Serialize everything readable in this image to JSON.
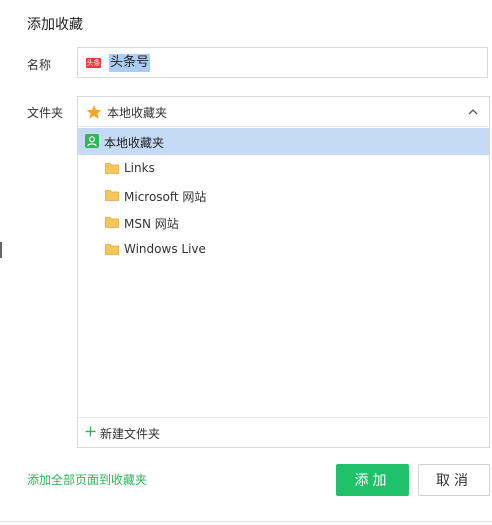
{
  "dialog": {
    "title": "添加收藏",
    "name_label": "名称",
    "folder_label": "文件夹"
  },
  "name_field": {
    "site_icon_text": "头条",
    "value": "头条号"
  },
  "folder_select": {
    "selected": "本地收藏夹",
    "icon": "star-icon",
    "expanded": true
  },
  "tree": {
    "root": {
      "label": "本地收藏夹",
      "icon": "user-icon"
    },
    "items": [
      {
        "label": "Links",
        "icon": "folder-icon"
      },
      {
        "label": "Microsoft 网站",
        "icon": "folder-icon"
      },
      {
        "label": "MSN 网站",
        "icon": "folder-icon"
      },
      {
        "label": "Windows Live",
        "icon": "folder-icon"
      }
    ]
  },
  "new_folder": {
    "label": "新建文件夹"
  },
  "footer": {
    "add_all_link": "添加全部页面到收藏夹",
    "add_button": "添加",
    "cancel_button": "取消"
  },
  "colors": {
    "accent_green": "#21c06b",
    "link_green": "#2fb45a",
    "selection_blue": "#c4daf5",
    "star_orange": "#f5a623",
    "folder_yellow": "#f6c65b",
    "site_icon_red": "#e8383d"
  }
}
